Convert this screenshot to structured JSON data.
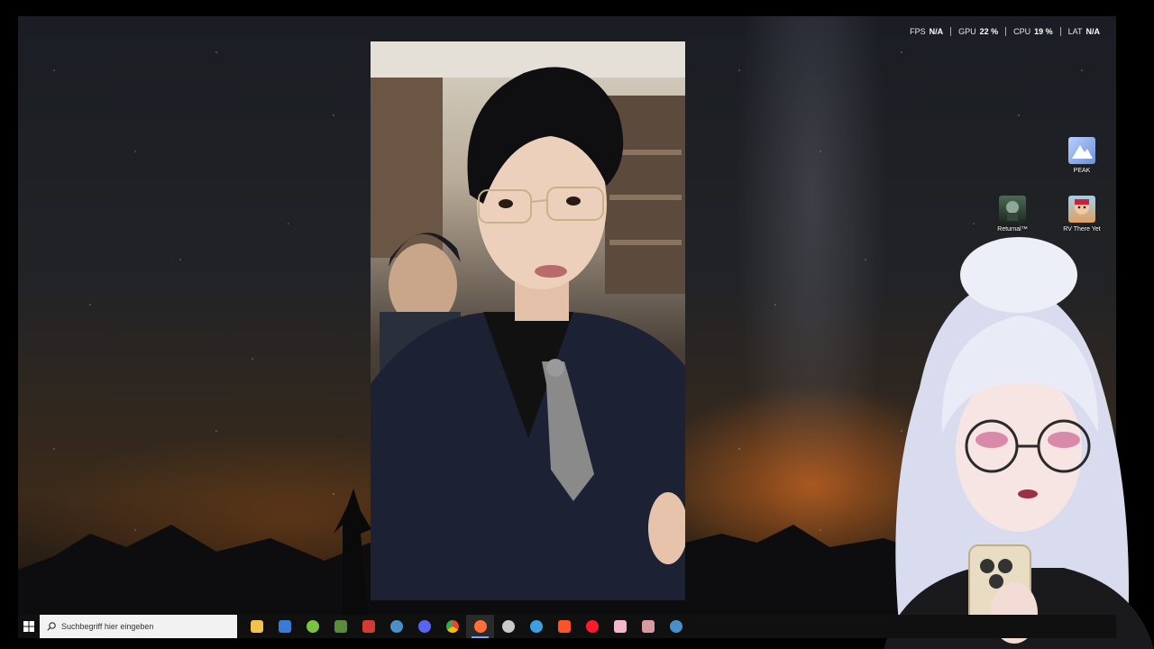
{
  "overlay": {
    "fps_label": "FPS",
    "fps_value": "N/A",
    "gpu_label": "GPU",
    "gpu_value": "22 %",
    "cpu_label": "CPU",
    "cpu_value": "19 %",
    "lat_label": "LAT",
    "lat_value": "N/A"
  },
  "desktop_icons": [
    {
      "label": "PEAK",
      "icon": "peak-game-icon",
      "color": "#7fa6e8"
    },
    {
      "label": "Returnal™",
      "icon": "returnal-game-icon",
      "color": "#2f4a3a"
    },
    {
      "label": "RV There Yet",
      "icon": "rv-there-yet-game-icon",
      "color": "#c9773a"
    }
  ],
  "taskbar": {
    "search_placeholder": "Suchbegriff hier eingeben",
    "apps": [
      {
        "name": "file-explorer",
        "color": "#f2c14e"
      },
      {
        "name": "microsoft-store",
        "color": "#3a7bd5"
      },
      {
        "name": "android-app",
        "color": "#7cc243"
      },
      {
        "name": "minecraft",
        "color": "#5b8c3a"
      },
      {
        "name": "news-app",
        "color": "#d23b2f"
      },
      {
        "name": "steam",
        "color": "#4b8fc8"
      },
      {
        "name": "discord",
        "color": "#5865f2"
      },
      {
        "name": "chrome",
        "color": "#ea4335"
      },
      {
        "name": "firefox",
        "color": "#ff7139"
      },
      {
        "name": "speedometer-app",
        "color": "#c9c9c9"
      },
      {
        "name": "blue-swirl-app",
        "color": "#3aa0e0"
      },
      {
        "name": "brave",
        "color": "#fb542b"
      },
      {
        "name": "opera",
        "color": "#ff1b2d"
      },
      {
        "name": "pink-app",
        "color": "#f4b6c8"
      },
      {
        "name": "tool-app",
        "color": "#d89aa0"
      },
      {
        "name": "steam-2",
        "color": "#4b8fc8"
      }
    ]
  }
}
